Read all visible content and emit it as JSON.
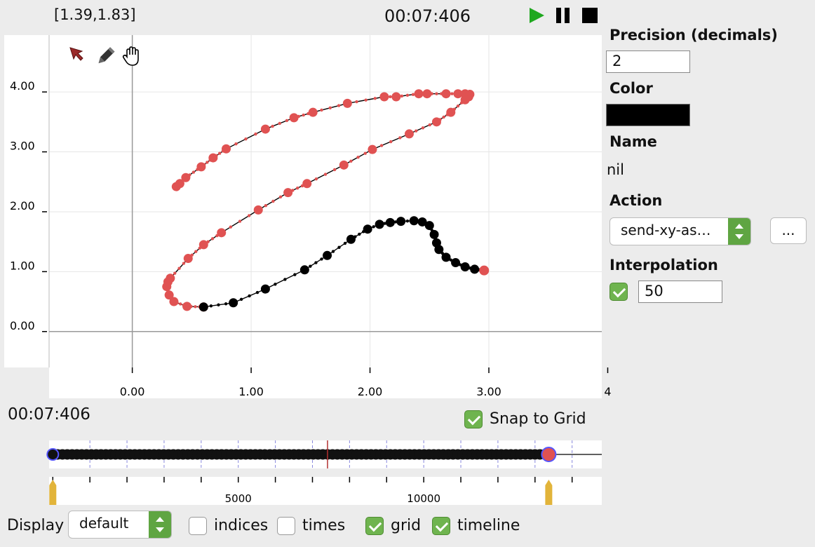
{
  "header": {
    "coord_readout": "[1.39,1.83]",
    "time": "00:07:406"
  },
  "icons": [
    "play-icon",
    "pause-icon",
    "stop-icon",
    "arrow-tool-icon",
    "pencil-tool-icon",
    "hand-tool-icon"
  ],
  "colors": {
    "play": "#1fa81f",
    "accent_green": "#6fb44f",
    "point_red": "#e05252",
    "point_black": "#000000",
    "playhead": "#b23030",
    "marker_gold": "#e2b43a"
  },
  "chart_data": {
    "type": "line",
    "grid": true,
    "xlim": [
      -0.7,
      3.95
    ],
    "ylim": [
      -0.6,
      4.95
    ],
    "x_ticks": [
      "0.00",
      "1.00",
      "2.00",
      "3.00",
      "4"
    ],
    "x_tick_values": [
      0,
      1,
      2,
      3,
      4
    ],
    "y_ticks": [
      "0.00",
      "1.00",
      "2.00",
      "3.00",
      "4.00"
    ],
    "y_tick_values": [
      0,
      1,
      2,
      3,
      4
    ],
    "series": [
      {
        "color": "#e05252",
        "points": [
          [
            0.37,
            2.42
          ],
          [
            0.4,
            2.47
          ],
          [
            0.45,
            2.57
          ],
          [
            0.58,
            2.75
          ],
          [
            0.68,
            2.9
          ],
          [
            0.79,
            3.05
          ],
          [
            1.12,
            3.38
          ],
          [
            1.36,
            3.57
          ],
          [
            1.52,
            3.66
          ],
          [
            1.81,
            3.81
          ],
          [
            2.12,
            3.92
          ],
          [
            2.22,
            3.92
          ],
          [
            2.41,
            3.97
          ],
          [
            2.48,
            3.97
          ],
          [
            2.64,
            3.97
          ],
          [
            2.74,
            3.97
          ],
          [
            2.8,
            3.97
          ],
          [
            2.84,
            3.96
          ],
          [
            2.83,
            3.92
          ],
          [
            2.8,
            3.87
          ],
          [
            2.68,
            3.66
          ],
          [
            2.56,
            3.5
          ],
          [
            2.33,
            3.3
          ],
          [
            2.02,
            3.04
          ],
          [
            1.78,
            2.78
          ],
          [
            1.47,
            2.47
          ],
          [
            1.31,
            2.32
          ],
          [
            1.06,
            2.03
          ],
          [
            0.75,
            1.65
          ],
          [
            0.6,
            1.45
          ],
          [
            0.47,
            1.22
          ],
          [
            0.32,
            0.89
          ],
          [
            0.3,
            0.83
          ],
          [
            0.29,
            0.75
          ],
          [
            0.31,
            0.61
          ],
          [
            0.35,
            0.5
          ],
          [
            0.46,
            0.42
          ],
          [
            0.6,
            0.41
          ]
        ]
      },
      {
        "color": "#000000",
        "points": [
          [
            0.6,
            0.41
          ],
          [
            0.85,
            0.48
          ],
          [
            1.12,
            0.71
          ],
          [
            1.45,
            1.03
          ],
          [
            1.64,
            1.27
          ],
          [
            1.84,
            1.54
          ],
          [
            1.98,
            1.71
          ],
          [
            2.08,
            1.79
          ],
          [
            2.17,
            1.82
          ],
          [
            2.26,
            1.84
          ],
          [
            2.37,
            1.85
          ],
          [
            2.44,
            1.83
          ],
          [
            2.5,
            1.77
          ],
          [
            2.54,
            1.62
          ],
          [
            2.56,
            1.48
          ],
          [
            2.58,
            1.37
          ],
          [
            2.64,
            1.24
          ],
          [
            2.72,
            1.15
          ],
          [
            2.8,
            1.08
          ],
          [
            2.88,
            1.04
          ],
          [
            2.96,
            1.02
          ]
        ]
      }
    ]
  },
  "timeline": {
    "time_label": "00:07:406",
    "snap_to_grid": {
      "label": "Snap to Grid",
      "checked": true
    },
    "ruler_labels": [
      "5000",
      "10000"
    ],
    "ruler_label_values": [
      5000,
      10000
    ],
    "range": [
      -100,
      14800
    ],
    "playhead_ms": 7406,
    "end_marker_ms": 13370
  },
  "sidebar": {
    "precision_title": "Precision (decimals)",
    "precision_value": "2",
    "color_title": "Color",
    "color_value": "#000000",
    "name_title": "Name",
    "name_value": "nil",
    "action_title": "Action",
    "action_value": "send-xy-as…",
    "action_more": "...",
    "interp_title": "Interpolation",
    "interp_checked": true,
    "interp_value": "50"
  },
  "footer": {
    "display_label": "Display",
    "display_value": "default",
    "options": [
      {
        "label": "indices",
        "checked": false
      },
      {
        "label": "times",
        "checked": false
      },
      {
        "label": "grid",
        "checked": true
      },
      {
        "label": "timeline",
        "checked": true
      }
    ]
  }
}
